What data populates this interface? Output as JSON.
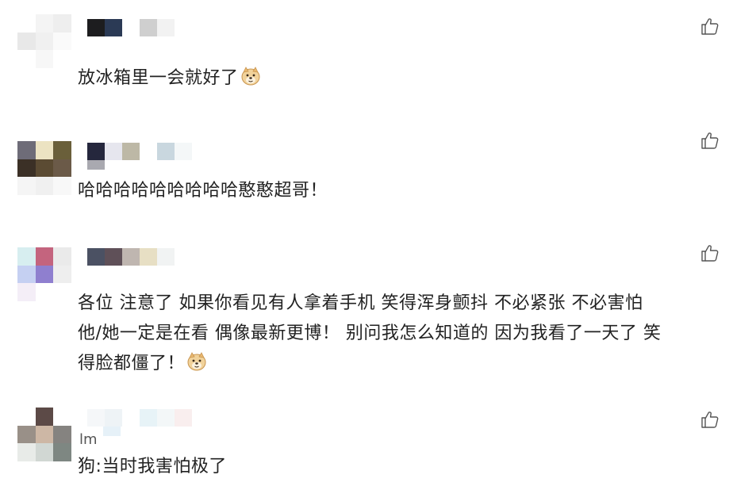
{
  "comments": [
    {
      "text": "放冰箱里一会就好了",
      "emoji": "doge-emoji",
      "avatar_colors": [
        "#ffffff",
        "#f4f4f4",
        "#eeeeee",
        "#e8e8e8",
        "#f0f0f0",
        "#fafafa",
        "#ffffff",
        "#f7f7f7",
        "#ffffff"
      ],
      "name_colors": [
        "#1d1d1f",
        "#2b3a55",
        "#ffffff",
        "#cfcfcf",
        "#f2f2f2"
      ]
    },
    {
      "text": "哈哈哈哈哈哈哈哈哈憨憨超哥！",
      "avatar_colors": [
        "#6e6c78",
        "#ece3c2",
        "#6a5f3a",
        "#3b3026",
        "#5b4b33",
        "#6b5a48",
        "#f5f5f5",
        "#f0f0f0",
        "#f8f8f8"
      ],
      "name_colors": [
        "#25273d",
        "#e6e6ee",
        "#bdb8a6",
        "#ffffff",
        "#c9d7df",
        "#f4f7f8"
      ],
      "sub_colors": [
        "#a9a9b0"
      ]
    },
    {
      "line1": "各位 注意了 如果你看见有人拿着手机 笑得浑身颤抖 不必紧张 不必害怕",
      "line2": "他/她一定是在看 偶像最新更博！ 别问我怎么知道的 因为我看了一天了 笑",
      "line3": "得脸都僵了！",
      "emoji": "doge-emoji",
      "avatar_colors": [
        "#d7eef0",
        "#c4647e",
        "#eaeaea",
        "#c5d0f2",
        "#8f7fcf",
        "#eeeeee",
        "#f4eef7",
        "#ffffff",
        "#ffffff"
      ],
      "name_colors": [
        "#4b5163",
        "#5f5058",
        "#bfb6b0",
        "#e7dfc4",
        "#f1f3f3"
      ]
    },
    {
      "sub_text": "lm",
      "text": "狗:当时我害怕极了",
      "avatar_colors": [
        "#ffffff",
        "#5c4a47",
        "#ffffff",
        "#999088",
        "#cdb7a5",
        "#858380",
        "#e8ebe8",
        "#d1d7d3",
        "#7e8782"
      ],
      "name_colors": [
        "#f5f7f9",
        "#eef3f6",
        "#ffffff",
        "#e7f3f7",
        "#f3f7f8",
        "#f9eeee"
      ],
      "sub_colors": [
        "#e6f1f8"
      ]
    }
  ],
  "like_icon": "thumbs-up-icon"
}
